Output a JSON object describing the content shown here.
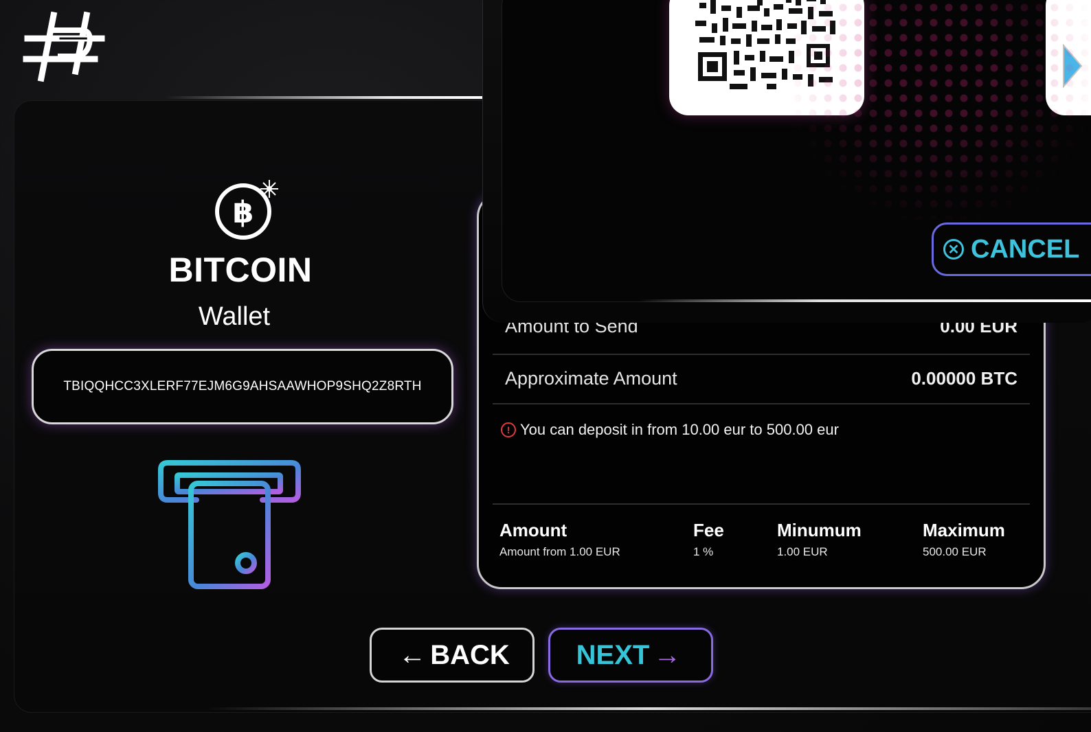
{
  "wallet": {
    "coin_name": "BITCOIN",
    "subtitle": "Wallet",
    "address": "TBIQQHCC3XLERF77EJM6G9AHSAAWHOP9SHQ2Z8RTH"
  },
  "modal": {
    "cancel_label": "CANCEL",
    "cancel_icon": "circle-x-icon"
  },
  "form": {
    "rows": [
      {
        "label": "Amount to Send",
        "value": "0.00 EUR"
      },
      {
        "label": "Approximate Amount",
        "value": "0.00000 BTC"
      }
    ],
    "note": "You can deposit in from 10.00 eur to 500.00 eur",
    "summary": [
      {
        "heading": "Amount",
        "detail": "Amount from 1.00 EUR"
      },
      {
        "heading": "Fee",
        "detail": "1 %"
      },
      {
        "heading": "Minumum",
        "detail": "1.00 EUR"
      },
      {
        "heading": "Maximum",
        "detail": "500.00 EUR"
      }
    ]
  },
  "nav": {
    "back_label": "BACK",
    "next_label": "NEXT"
  },
  "colors": {
    "accent_cyan": "#35c4d8",
    "accent_purple": "#a86ce0",
    "warning_red": "#e03a3a",
    "dot_pink": "#c82878"
  }
}
